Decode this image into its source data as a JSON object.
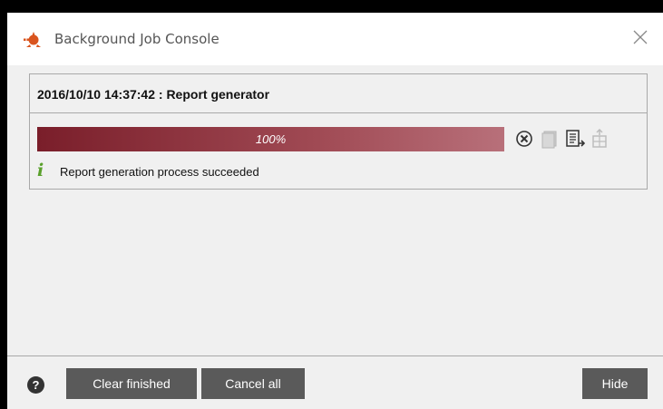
{
  "window": {
    "title": "Background Job Console",
    "icons": {
      "app": "app-logo-icon",
      "close": "close-icon"
    }
  },
  "job": {
    "header": "2016/10/10 14:37:42 : Report generator",
    "progress_label": "100%",
    "progress_value": 1.0,
    "status_text": "Report generation process succeeded",
    "status_icon": "info-icon",
    "actions": [
      {
        "name": "cancel-job-icon",
        "enabled": true
      },
      {
        "name": "view-log-icon",
        "enabled": false
      },
      {
        "name": "export-log-icon",
        "enabled": true
      },
      {
        "name": "open-result-icon",
        "enabled": false
      }
    ]
  },
  "footer": {
    "help_icon": "help-icon",
    "clear_finished": "Clear finished",
    "cancel_all": "Cancel all",
    "hide": "Hide"
  },
  "colors": {
    "progress_start": "#7a1e2a",
    "progress_end": "#b8707a",
    "button_bg": "#5a5a5a",
    "status_icon": "#5aa02c"
  }
}
